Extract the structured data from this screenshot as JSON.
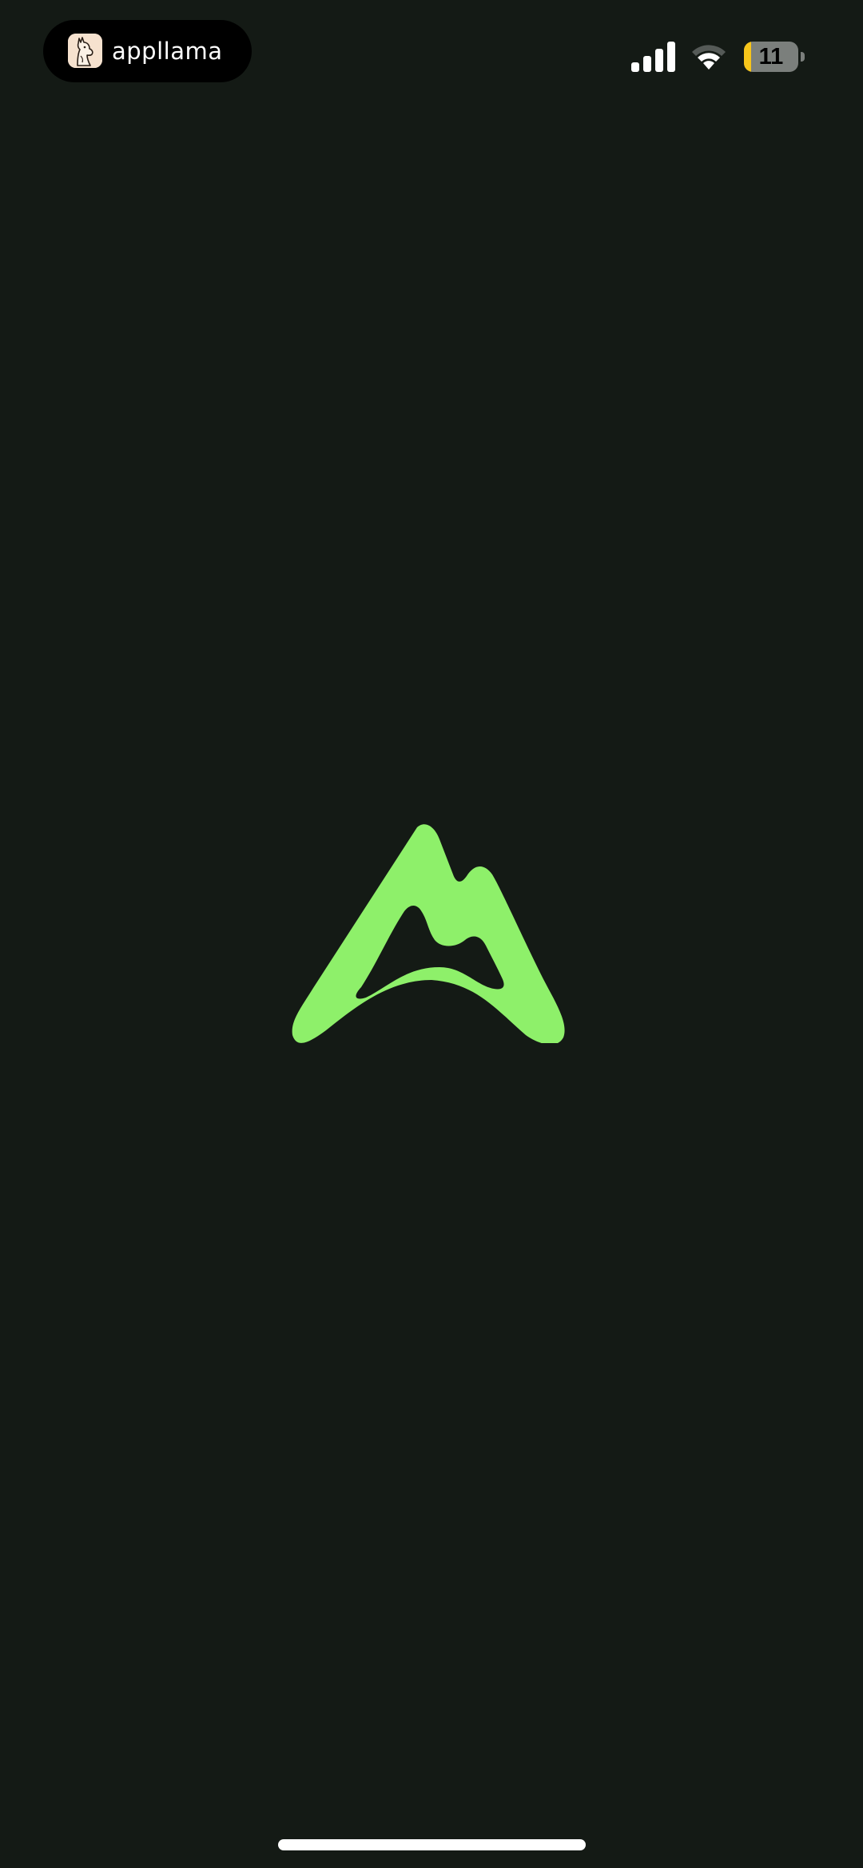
{
  "status_bar": {
    "app_label": "appllama",
    "app_icon": "llama-icon",
    "battery_level": "11",
    "battery_color": "#f7c51a",
    "signal_icon": "cellular-signal-icon",
    "wifi_icon": "wifi-icon"
  },
  "splash": {
    "logo_icon": "mountain-logo-icon",
    "logo_color": "#8ef06a",
    "background_color": "#141a15"
  }
}
